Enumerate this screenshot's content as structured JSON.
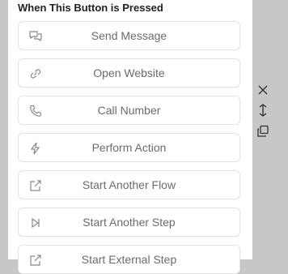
{
  "title": "When This Button is Pressed",
  "options": [
    {
      "label": "Send Message",
      "icon": "chat-bubbles-icon"
    },
    {
      "label": "Open Website",
      "icon": "link-icon"
    },
    {
      "label": "Call Number",
      "icon": "phone-icon"
    },
    {
      "label": "Perform Action",
      "icon": "lightning-icon"
    },
    {
      "label": "Start Another Flow",
      "icon": "external-arrow-icon"
    },
    {
      "label": "Start Another Step",
      "icon": "skip-step-icon"
    },
    {
      "label": "Start External Step",
      "icon": "external-arrow-icon"
    }
  ],
  "controls": [
    {
      "icon": "close-icon"
    },
    {
      "icon": "move-vertical-icon"
    },
    {
      "icon": "duplicate-icon"
    }
  ],
  "colors": {
    "panel": "#ffffff",
    "backdrop": "#c7c7c7",
    "text": "#6b6b6b",
    "border": "#e3e3e3"
  }
}
